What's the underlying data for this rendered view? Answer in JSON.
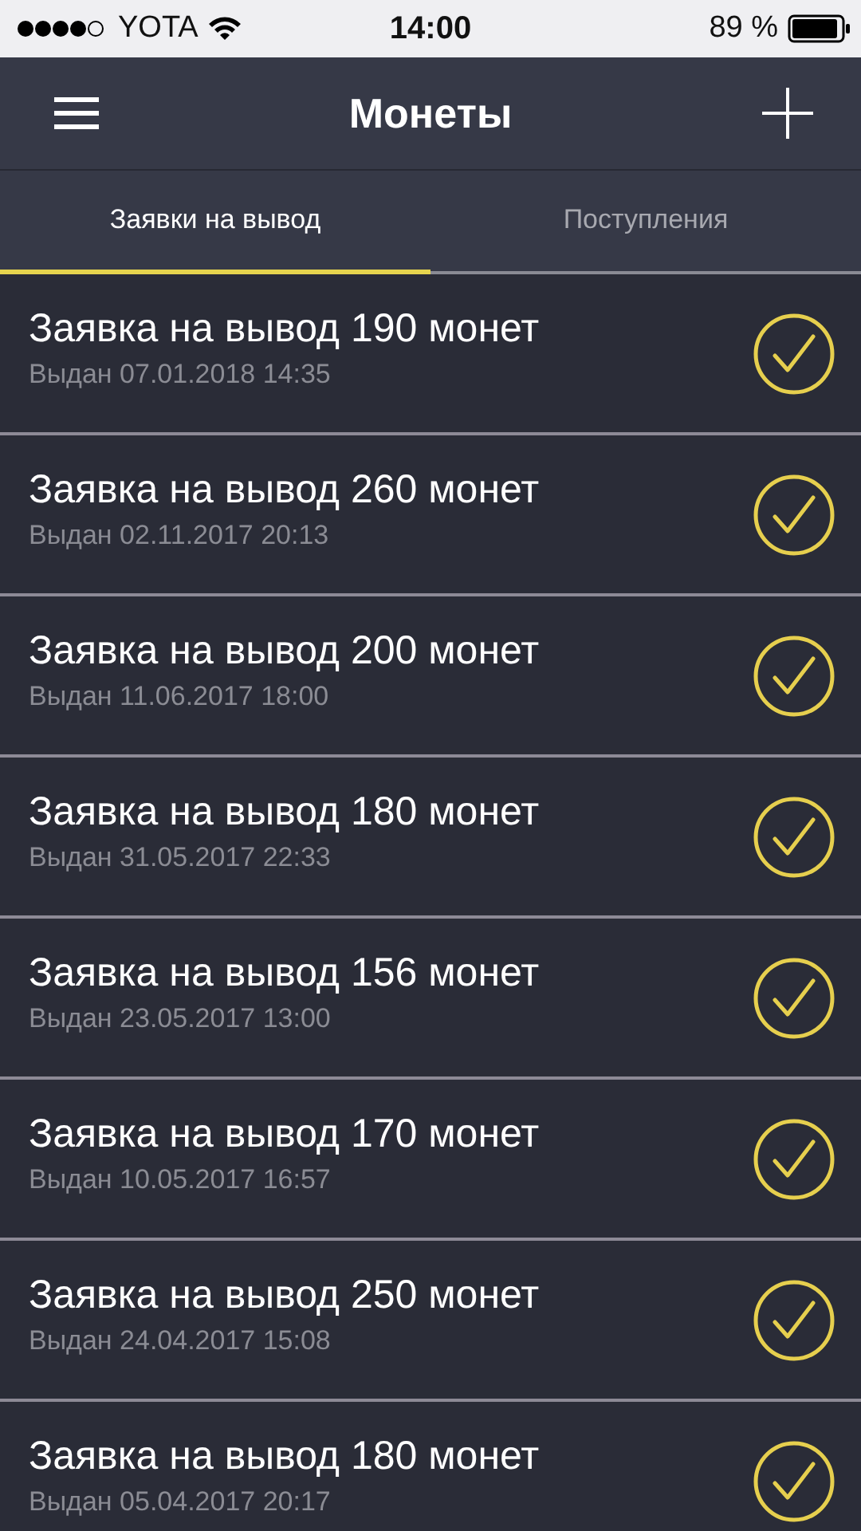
{
  "status_bar": {
    "carrier": "YOTA",
    "time": "14:00",
    "battery": "89 %"
  },
  "header": {
    "title": "Монеты"
  },
  "tabs": [
    {
      "label": "Заявки на вывод",
      "selected": true
    },
    {
      "label": "Поступления",
      "selected": false
    }
  ],
  "requests": [
    {
      "title": "Заявка на вывод 190 монет",
      "date": "Выдан 07.01.2018 14:35"
    },
    {
      "title": "Заявка на вывод 260 монет",
      "date": "Выдан 02.11.2017 20:13"
    },
    {
      "title": "Заявка на вывод 200 монет",
      "date": "Выдан 11.06.2017 18:00"
    },
    {
      "title": "Заявка на вывод 180 монет",
      "date": "Выдан 31.05.2017 22:33"
    },
    {
      "title": "Заявка на вывод 156 монет",
      "date": "Выдан 23.05.2017 13:00"
    },
    {
      "title": "Заявка на вывод 170 монет",
      "date": "Выдан 10.05.2017 16:57"
    },
    {
      "title": "Заявка на вывод 250 монет",
      "date": "Выдан 24.04.2017 15:08"
    },
    {
      "title": "Заявка на вывод 180 монет",
      "date": "Выдан 05.04.2017 20:17"
    }
  ]
}
